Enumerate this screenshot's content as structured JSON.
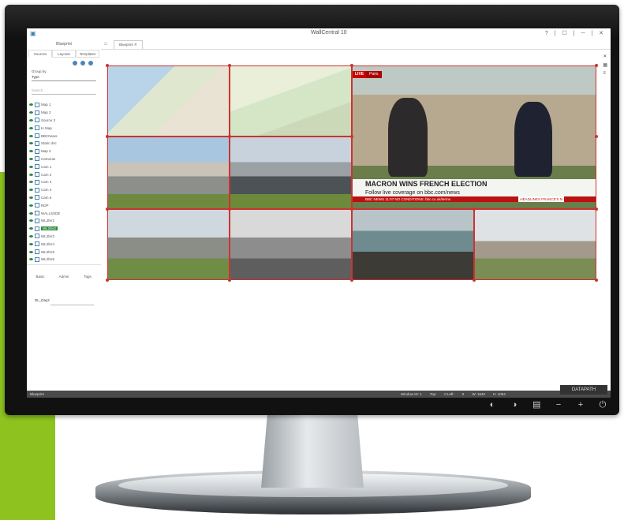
{
  "app": {
    "title": "WallCentral 10",
    "window_controls": "? | ☐ | ─ | ✕"
  },
  "sidebar": {
    "title": "Blueprint",
    "tabs": [
      "Sources",
      "Layouts",
      "Templates"
    ],
    "filter_label": "Group by",
    "filter_value": "Type",
    "search_placeholder": "Search...",
    "tree": [
      {
        "label": "Map 1",
        "selected": false
      },
      {
        "label": "Map 2",
        "selected": false
      },
      {
        "label": "Source 3",
        "selected": false
      },
      {
        "label": "In Map",
        "selected": false
      },
      {
        "label": "BBCNews",
        "selected": false
      },
      {
        "label": "Static doc",
        "selected": false
      },
      {
        "label": "Map 3",
        "selected": false
      },
      {
        "label": "Cameras",
        "selected": false
      },
      {
        "label": "Cam 1",
        "selected": false
      },
      {
        "label": "Cam 2",
        "selected": false
      },
      {
        "label": "Cam 3",
        "selected": false
      },
      {
        "label": "Cam 4",
        "selected": false
      },
      {
        "label": "Cam 5",
        "selected": false
      },
      {
        "label": "RDP",
        "selected": false
      },
      {
        "label": "WALLSSDE",
        "selected": false
      },
      {
        "label": "WL2fer1",
        "selected": false
      },
      {
        "label": "WL2fer2",
        "selected": true
      },
      {
        "label": "WL2fer3",
        "selected": false
      },
      {
        "label": "WL2fer4",
        "selected": false
      },
      {
        "label": "WL2fer5",
        "selected": false
      },
      {
        "label": "WL2fer6",
        "selected": false
      }
    ],
    "bottom_tabs": [
      "Basic",
      "Admin",
      "Tags"
    ],
    "bottom_field": "DL_Day2",
    "footer": "Blueprint"
  },
  "main": {
    "doc_tab": "Blueprint",
    "news": {
      "live_badge": "LIVE",
      "live_location": "Paris",
      "headline": "MACRON WINS FRENCH ELECTION",
      "subline": "Follow live coverage on bbc.com/news",
      "ticker": "BBC NEWS   11:07  NO CONDITIONS: bbc.co.uk/terms",
      "ticker_badge": "HEADLINES  FRANCE'S N"
    },
    "status": [
      "Window ID: 1",
      "Top:",
      "0 Left:",
      "0",
      "W: 1640",
      "H: 1054"
    ]
  },
  "colors": {
    "accent": "#8dc21f",
    "tile_border": "#cc3333",
    "live_red": "#cc0000",
    "tree_selected": "#2e8b3c"
  },
  "monitor": {
    "brand": "DATAPATH",
    "bezel_buttons": [
      "power-icon",
      "plus-icon",
      "minus-icon",
      "menu-icon",
      "source-icon",
      "auto-icon"
    ]
  }
}
